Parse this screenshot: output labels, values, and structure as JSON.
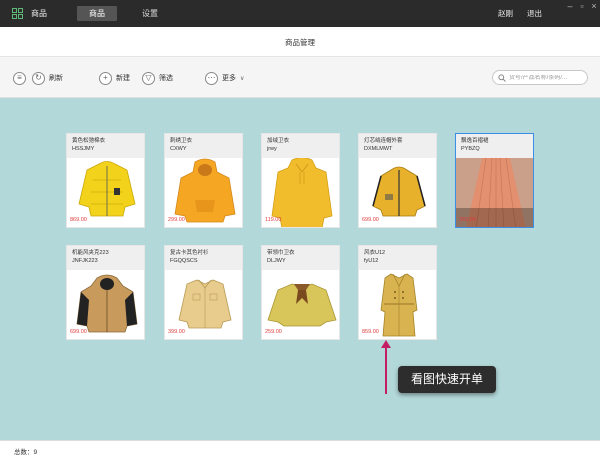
{
  "app": {
    "name": "商品"
  },
  "nav": {
    "tabs": [
      {
        "label": "商品",
        "active": true
      },
      {
        "label": "设置",
        "active": false
      }
    ]
  },
  "user": {
    "name": "赵刚",
    "logout": "退出"
  },
  "page": {
    "title": "商品管理"
  },
  "toolbar": {
    "refresh": "刷新",
    "new": "新建",
    "filter": "筛选",
    "more": "更多"
  },
  "search": {
    "placeholder": "货号/产品名称/条码/..."
  },
  "products": [
    {
      "name": "黄色松弛棉衣",
      "code": "HSSJMY",
      "price": "869.00",
      "color": "#f2d21a",
      "selected": false
    },
    {
      "name": "刺绣卫衣",
      "code": "CXWY",
      "price": "299.00",
      "color": "#f5a623",
      "selected": false
    },
    {
      "name": "加绒卫衣",
      "code": "jrwy",
      "price": "119.00",
      "color": "#f2bd2c",
      "selected": false
    },
    {
      "name": "灯芯绒连帽外套",
      "code": "DXMLMWT",
      "price": "699.00",
      "color": "#e8b12b",
      "selected": false
    },
    {
      "name": "飘逸百褶裙",
      "code": "PYBZQ",
      "price": "269.00",
      "color": "#e2906f",
      "selected": true
    },
    {
      "name": "机能风夹克223",
      "code": "JNFJK223",
      "price": "699.00",
      "color": "#c89a5c",
      "selected": false
    },
    {
      "name": "复古卡其色衬衫",
      "code": "FGQQSCS",
      "price": "399.00",
      "color": "#e7cc8d",
      "selected": false
    },
    {
      "name": "带领巾卫衣",
      "code": "DLJWY",
      "price": "259.00",
      "color": "#d9c65b",
      "selected": false
    },
    {
      "name": "风衣U12",
      "code": "fyU12",
      "price": "859.00",
      "color": "#d9b34f",
      "selected": false
    }
  ],
  "tooltip": {
    "text": "看图快速开单"
  },
  "footer": {
    "label": "总数：",
    "total": "9"
  }
}
